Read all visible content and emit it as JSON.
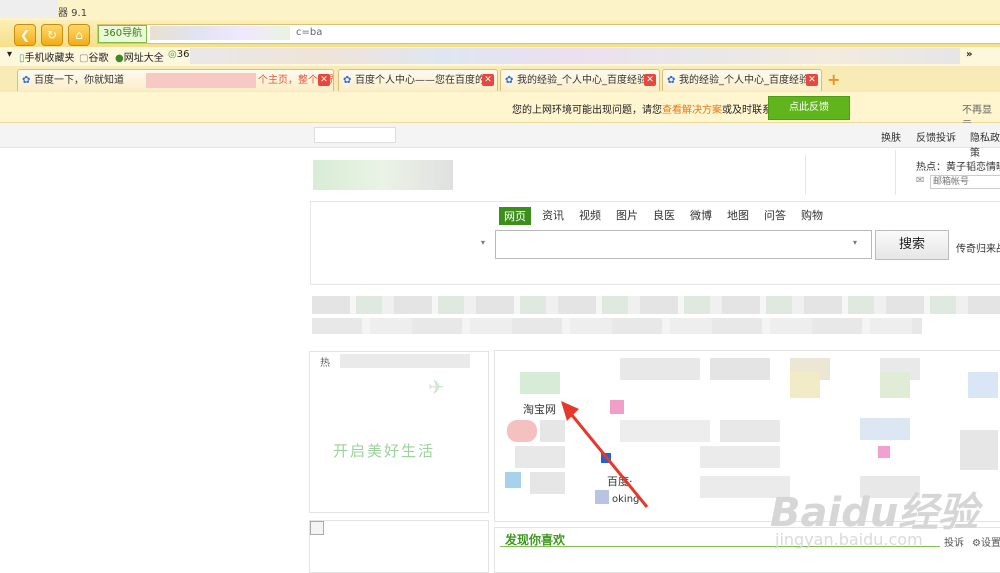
{
  "window": {
    "title": "器 9.1"
  },
  "nav": {
    "back": "❮",
    "refresh": "↻",
    "home": "⌂"
  },
  "address": {
    "badge": "360导航",
    "url_fragment": "c=ba"
  },
  "bookmarks": [
    "手机收藏夹",
    "谷歌",
    "网址大全",
    "36"
  ],
  "tabs": [
    {
      "label": "百度一下，你就知道"
    },
    {
      "label": "个主页，整个世界"
    },
    {
      "label": "百度个人中心——您在百度的"
    },
    {
      "label": "我的经验_个人中心_百度经验"
    },
    {
      "label": "我的经验_个人中心_百度经验"
    }
  ],
  "notice": {
    "text_prefix": "您的上网环境可能出现问题，请您",
    "link": "查看解决方案",
    "text_suffix": "或及时联系我们",
    "button": "点此反馈",
    "hide": "不再显示"
  },
  "top_links": [
    "换肤",
    "反馈投诉",
    "隐私政策"
  ],
  "hot": {
    "label": "热点：黄子韬恋情曝",
    "email_placeholder": "邮箱帐号"
  },
  "search": {
    "tabs": [
      "网页",
      "资讯",
      "视频",
      "图片",
      "良医",
      "微博",
      "地图",
      "问答",
      "购物"
    ],
    "button": "搜索",
    "side": "传奇归来战"
  },
  "left_panel": {
    "heading": "热",
    "slogan": "开启美好生活"
  },
  "sites": [
    "淘宝网",
    "百度·",
    "oking"
  ],
  "discover": {
    "title": "发现你喜欢",
    "complain": "投诉",
    "settings": "设置"
  },
  "watermark": {
    "brand": "Baidu经验",
    "domain": "jingyan.baidu.com"
  },
  "colors": {
    "accent_green": "#3d8f1b",
    "notice_bg": "#fff6cf",
    "tab_close": "#e8483c"
  }
}
